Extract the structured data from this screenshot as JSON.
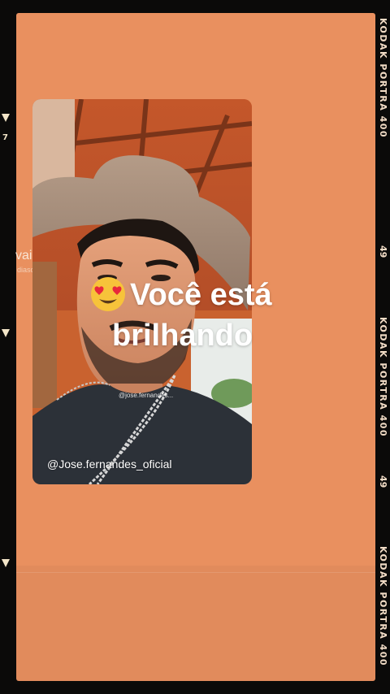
{
  "film_strip": {
    "brand_label_1": "KODAK PORTRA 400",
    "frame_number_1": "49",
    "brand_label_2": "KODAK PORTRA 400",
    "frame_number_2": "49",
    "brand_label_3": "KODAK PORTRA 400",
    "left_number": "7"
  },
  "background_ghost": {
    "text_1": "vai",
    "text_2": "diaso"
  },
  "photo": {
    "inner_watermark": "@jose.fernandes...",
    "handle": "@Jose.fernandes_oficial"
  },
  "caption": {
    "emoji_name": "heart-eyes-emoji",
    "line1": "Você está",
    "line2": "brilhando"
  },
  "colors": {
    "frame": "#e9905f",
    "film_border": "#0b0a09",
    "caption_text": "#ffffff"
  }
}
